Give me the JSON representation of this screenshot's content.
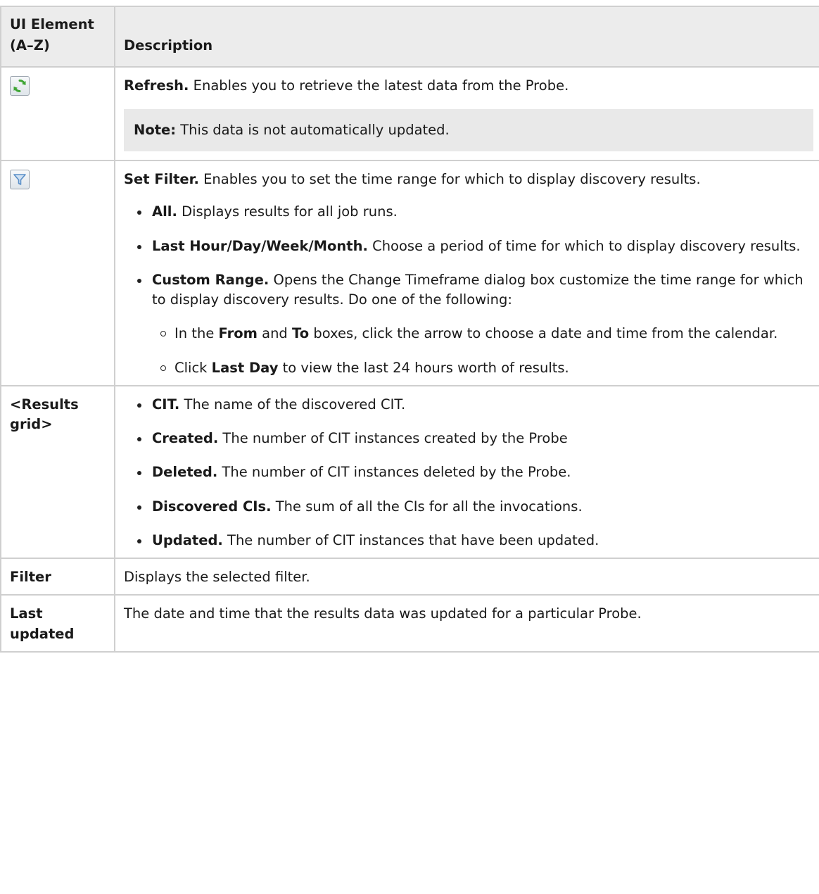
{
  "table": {
    "header": {
      "col1": "UI Element (A–Z)",
      "col2": "Description"
    },
    "refresh": {
      "icon": "refresh-icon",
      "title": "Refresh.",
      "text": " Enables you to retrieve the latest data from the Probe.",
      "note_label": "Note:",
      "note_text": " This data is not automatically updated."
    },
    "set_filter": {
      "icon": "filter-icon",
      "title": "Set Filter.",
      "text": " Enables you to set the time range for which to display discovery results.",
      "items": [
        {
          "title": "All.",
          "text": " Displays results for all job runs."
        },
        {
          "title": "Last Hour/Day/Week/Month.",
          "text": " Choose a period of time for which to display discovery results."
        },
        {
          "title": "Custom Range.",
          "text": " Opens the Change Timeframe dialog box customize the time range for which to display discovery results. Do one of the following:"
        }
      ],
      "sub_items": {
        "s1_a": "In the ",
        "s1_from": "From",
        "s1_b": " and ",
        "s1_to": "To",
        "s1_c": " boxes, click the arrow to choose a date and time from the calendar.",
        "s2_a": "Click ",
        "s2_b": "Last Day",
        "s2_c": " to view the last 24 hours worth of results."
      }
    },
    "results_grid": {
      "element": "<Results grid>",
      "items": [
        {
          "title": "CIT.",
          "text": " The name of the discovered CIT."
        },
        {
          "title": "Created.",
          "text": " The number of CIT instances created by the Probe"
        },
        {
          "title": "Deleted.",
          "text": " The number of CIT instances deleted by the Probe."
        },
        {
          "title": "Discovered CIs.",
          "text": " The sum of all the CIs for all the invocations."
        },
        {
          "title": "Updated.",
          "text": " The number of CIT instances that have been updated."
        }
      ]
    },
    "filter": {
      "element": "Filter",
      "text": "Displays the selected filter."
    },
    "last_updated": {
      "element": "Last updated",
      "text": "The date and time that the results data was updated for a particular Probe."
    }
  },
  "colors": {
    "header_bg": "#ececec",
    "border": "#cfcfcf",
    "note_bg": "#e9e9e9",
    "refresh_green": "#3fa535",
    "filter_blue": "#5a8fc8"
  }
}
